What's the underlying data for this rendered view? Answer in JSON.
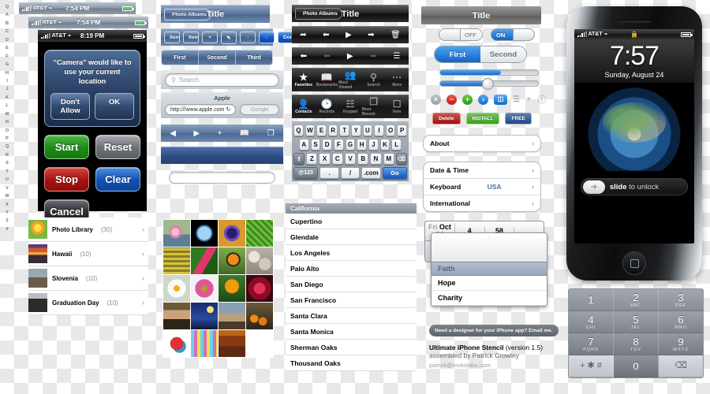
{
  "title": "Ultimate iPhone Stencil",
  "index_letters": [
    "Q",
    "A",
    "B",
    "C",
    "D",
    "E",
    "F",
    "G",
    "H",
    "I",
    "J",
    "K",
    "L",
    "M",
    "N",
    "O",
    "P",
    "Q",
    "R",
    "S",
    "T",
    "U",
    "V",
    "W",
    "X",
    "Y",
    "Z",
    "#"
  ],
  "status_bars": [
    {
      "carrier": "AT&T",
      "time": "7:54 PM",
      "style": "light"
    },
    {
      "carrier": "AT&T",
      "time": "7:54 PM",
      "style": "light"
    },
    {
      "carrier": "AT&T",
      "time": "8:19 PM",
      "style": "dark"
    }
  ],
  "alert": {
    "message": "“Camera” would like to use your current location",
    "deny_label": "Don't Allow",
    "ok_label": "OK"
  },
  "buttons": [
    {
      "label": "Start",
      "color": "#1d8b1a"
    },
    {
      "label": "Reset",
      "color": "#6e7277"
    },
    {
      "label": "Stop",
      "color": "#a5140f"
    },
    {
      "label": "Clear",
      "color": "#1552b5"
    },
    {
      "label": "Cancel",
      "color": "#2c3034"
    }
  ],
  "player": {
    "prev_icon": "skip-back-icon",
    "pause_icon": "pause-icon",
    "next_icon": "skip-forward-icon",
    "progress": 92
  },
  "albums": [
    {
      "name": "Photo Library",
      "count": "(30)",
      "thumb": "th-sun"
    },
    {
      "name": "Hawaii",
      "count": "(10)",
      "thumb": "th-hawaii"
    },
    {
      "name": "Slovenia",
      "count": "(10)",
      "thumb": "th-slov"
    },
    {
      "name": "Graduation Day",
      "count": "(10)",
      "thumb": "th-grad"
    }
  ],
  "navbar_blue": {
    "back_label": "Photo Albums",
    "title": "Title"
  },
  "toolbar_blue": {
    "items": [
      "Item",
      "Item"
    ],
    "add_icon": "plus-icon",
    "compose_icon": "compose-icon",
    "refresh_icon": "circle-icon",
    "refresh_sel_icon": "circle-selected-icon",
    "done_label": "Done"
  },
  "segmented_blue": [
    "First",
    "Second",
    "Third"
  ],
  "search": {
    "placeholder": "Search",
    "icon": "search-icon"
  },
  "browser": {
    "page_title": "Apple",
    "url": "http:///www.apple.com",
    "reload_icon": "reload-icon",
    "search_placeholder": "Google"
  },
  "safari_toolbar": [
    "back-icon",
    "forward-icon",
    "plus-icon",
    "bookmarks-icon",
    "pages-icon"
  ],
  "navbar_black": {
    "back_label": "Photo Albums",
    "title": "Title"
  },
  "toolbar_black_1": [
    "share-icon",
    "back-icon",
    "play-icon",
    "forward-icon",
    "trash-icon"
  ],
  "toolbar_black_2": [
    "back-icon",
    "back-dim-icon",
    "play-icon",
    "forward-dim-icon",
    "list-icon"
  ],
  "tabbar_1": [
    {
      "label": "Favorites",
      "icon": "star-icon",
      "active": true
    },
    {
      "label": "Bookmarks",
      "icon": "book-icon",
      "active": false
    },
    {
      "label": "Most Viewed",
      "icon": "people-icon",
      "active": false
    },
    {
      "label": "Search",
      "icon": "search-icon",
      "active": false
    },
    {
      "label": "More",
      "icon": "more-icon",
      "active": false
    }
  ],
  "tabbar_2": [
    {
      "label": "Contacts",
      "icon": "person-icon",
      "active": true
    },
    {
      "label": "Recents",
      "icon": "clock-icon",
      "active": false
    },
    {
      "label": "Keypad",
      "icon": "keypad-icon",
      "active": false
    },
    {
      "label": "Most Recent",
      "icon": "add-contact-icon",
      "active": false
    },
    {
      "label": "Item",
      "icon": "square-icon",
      "active": false
    }
  ],
  "keyboard": {
    "row1": [
      "Q",
      "W",
      "E",
      "R",
      "T",
      "Y",
      "U",
      "I",
      "O",
      "P"
    ],
    "row2": [
      "A",
      "S",
      "D",
      "F",
      "G",
      "H",
      "J",
      "K",
      "L"
    ],
    "row3": [
      "Z",
      "X",
      "C",
      "V",
      "B",
      "N",
      "M"
    ],
    "shift_icon": "shift-icon",
    "delete_icon": "delete-icon",
    "num_label": "@123",
    "period_label": ".",
    "slash_label": "/",
    "dotcom_label": ".com",
    "go_label": "Go"
  },
  "city_section": "California",
  "cities": [
    "Cupertino",
    "Glendale",
    "Los Angeles",
    "Palo Alto",
    "San Diego",
    "San Francisco",
    "Santa Clara",
    "Santa Monica",
    "Sherman Oaks",
    "Thousand Oaks"
  ],
  "navbar_gray_title": "Title",
  "switches": [
    {
      "label": "OFF",
      "state": "off"
    },
    {
      "label": "ON",
      "state": "on"
    }
  ],
  "segmented_big": [
    "First",
    "Second"
  ],
  "sliders": [
    {
      "fill": 62,
      "knob": false
    },
    {
      "fill": 50,
      "knob": true
    }
  ],
  "small_icons": [
    {
      "name": "close-icon",
      "glyph": "×",
      "style": "gray"
    },
    {
      "name": "delete-minus-icon",
      "glyph": "−",
      "style": "red"
    },
    {
      "name": "add-plus-icon",
      "glyph": "+",
      "style": "green"
    },
    {
      "name": "disclosure-icon",
      "glyph": "›",
      "style": "blue"
    },
    {
      "name": "book-badge-icon",
      "glyph": "◫",
      "style": "book"
    },
    {
      "name": "reorder-icon",
      "glyph": "≡",
      "style": "plain"
    },
    {
      "name": "spinner-icon",
      "glyph": "✵",
      "style": "plain"
    },
    {
      "name": "info-icon",
      "glyph": "ⓘ",
      "style": "plain"
    }
  ],
  "pills": [
    {
      "label": "Delete",
      "kind": "del"
    },
    {
      "label": "INSTALL",
      "kind": "inst"
    },
    {
      "label": "FREE",
      "kind": "free"
    }
  ],
  "settings_single": [
    {
      "label": "About"
    }
  ],
  "settings_group": [
    {
      "label": "Date & Time",
      "value": ""
    },
    {
      "label": "Keyboard",
      "value": "USA"
    },
    {
      "label": "International",
      "value": ""
    }
  ],
  "datepicker": {
    "day": "Fri",
    "date": "Oct 24",
    "hour": "4",
    "minute": "58"
  },
  "picker": {
    "selected": "Faith",
    "rows": [
      "Hope",
      "Charity"
    ]
  },
  "tooltip": "Need a designer for your iPhone app? Email me.",
  "credits": {
    "line1_bold": "Ultimate iPhone Stencil",
    "line1_rest": " (version 1.5)",
    "line2": "assembled by Patrick Crowley",
    "line3": "patrick@mokolabs.com"
  },
  "iphone": {
    "carrier": "AT&T",
    "lock_icon": "lock-icon",
    "time": "7:57",
    "date": "Sunday, August 24",
    "unlock_text_bold": "slide",
    "unlock_text_rest": " to unlock",
    "unlock_arrow": "arrow-right-icon"
  },
  "keypad": [
    [
      {
        "n": "1",
        "l": ""
      },
      {
        "n": "2",
        "l": "ABC"
      },
      {
        "n": "3",
        "l": "DEF"
      }
    ],
    [
      {
        "n": "4",
        "l": "GHI"
      },
      {
        "n": "5",
        "l": "JKL"
      },
      {
        "n": "6",
        "l": "MNO"
      }
    ],
    [
      {
        "n": "7",
        "l": "PQRS"
      },
      {
        "n": "8",
        "l": "TUV"
      },
      {
        "n": "9",
        "l": "WXYZ"
      }
    ],
    [
      {
        "n": "+ ✱ #",
        "l": ""
      },
      {
        "n": "0",
        "l": ""
      },
      {
        "n": "⌫",
        "l": ""
      }
    ]
  ]
}
